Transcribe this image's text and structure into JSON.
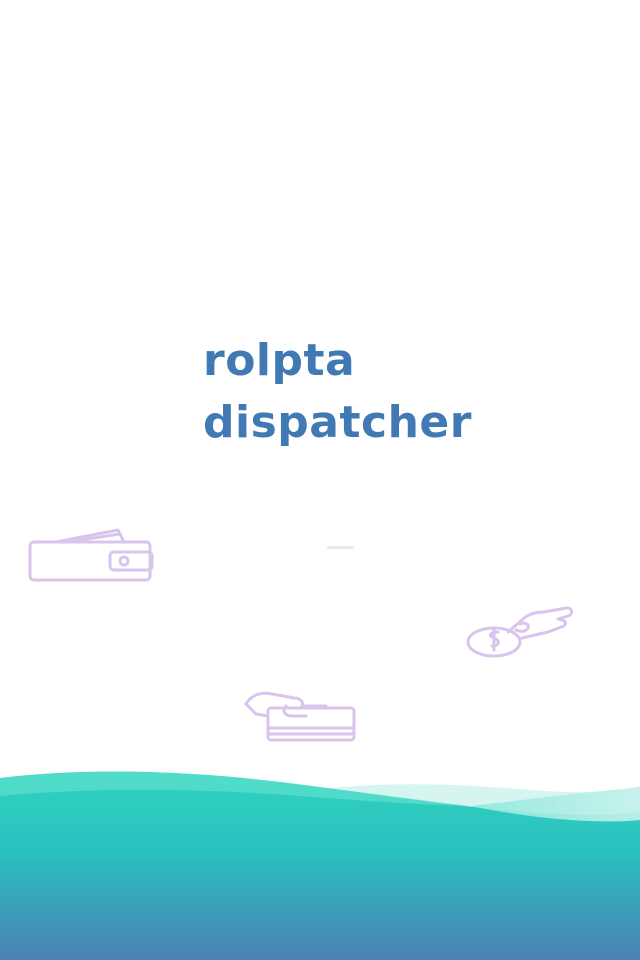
{
  "splash": {
    "title_line1": "rolpta",
    "title_line2": "dispatcher"
  },
  "icons": {
    "wallet": "wallet-icon",
    "coin_hand": "hand-giving-coin-icon",
    "cash_hand": "hand-taking-cash-icon",
    "loader": "loading-indicator"
  },
  "colors": {
    "title": "#4079b3",
    "icon_stroke": "#d9c4ee",
    "wave_top": "#2fd3bd",
    "wave_bottom": "#4a80b3",
    "background": "#ffffff"
  }
}
